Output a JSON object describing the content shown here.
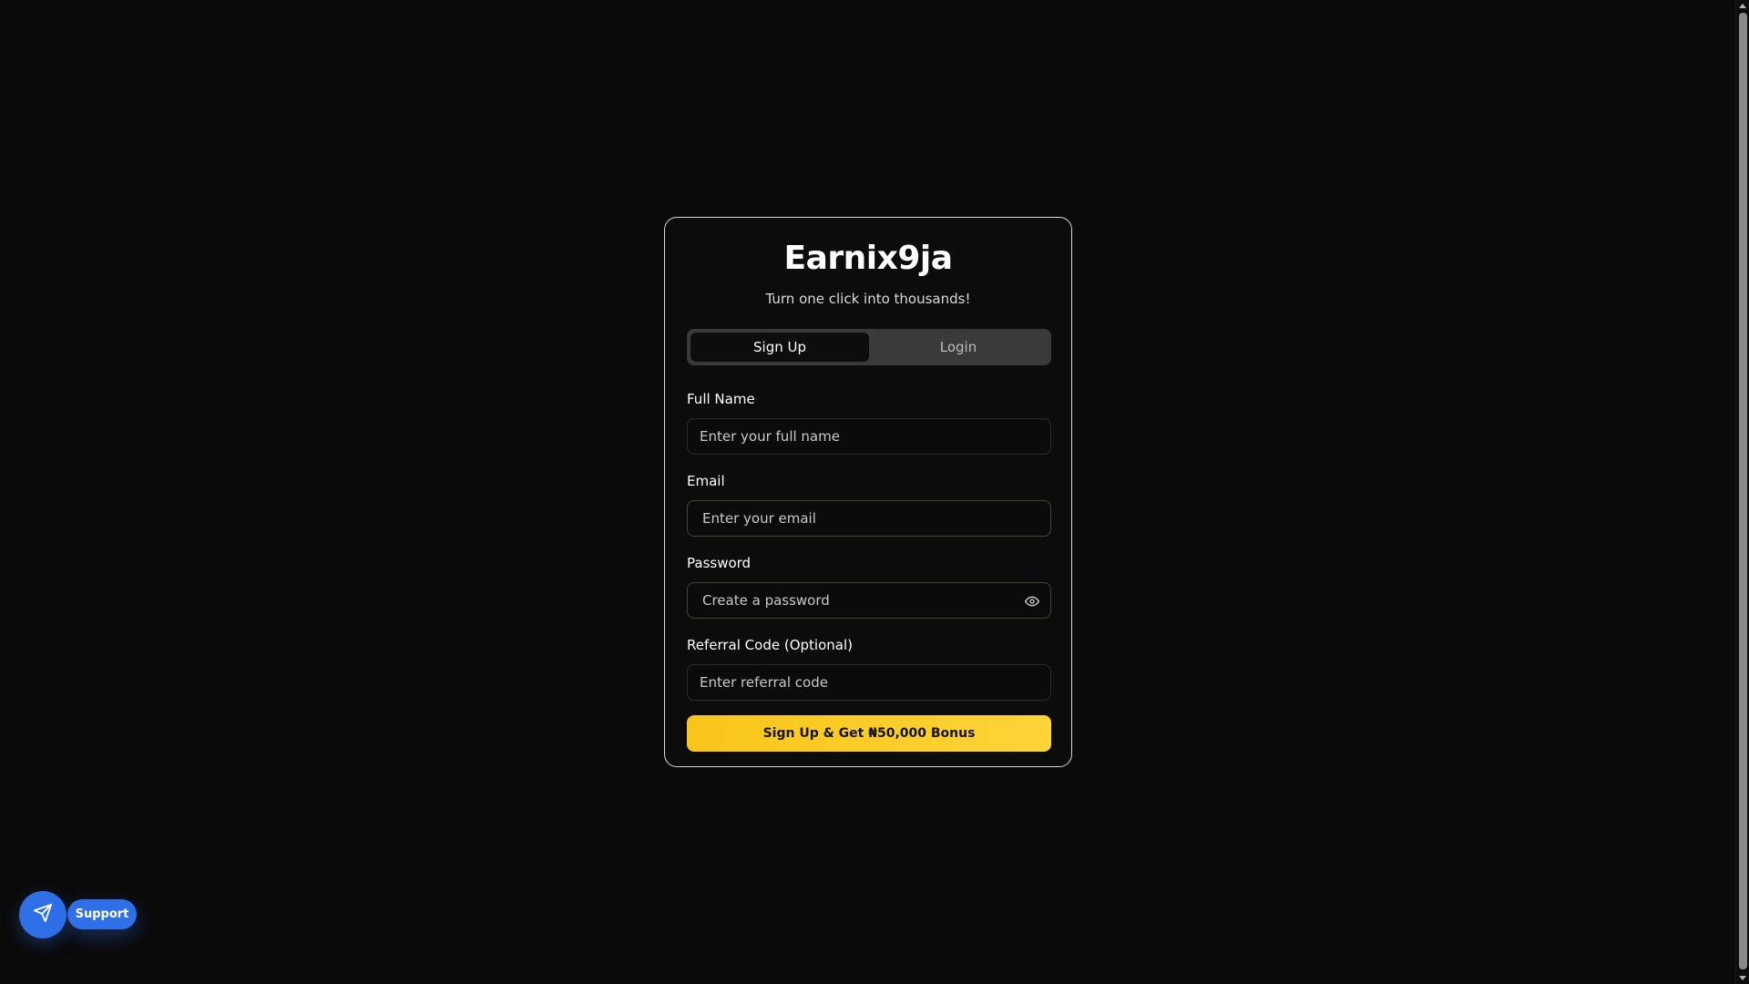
{
  "brand": {
    "name": "Earnix9ja",
    "tagline": "Turn one click into thousands!"
  },
  "tabs": [
    {
      "label": "Sign Up",
      "active": true
    },
    {
      "label": "Login",
      "active": false
    }
  ],
  "form": {
    "full_name": {
      "label": "Full Name",
      "placeholder": "Enter your full name",
      "value": ""
    },
    "email": {
      "label": "Email",
      "placeholder": "Enter your email",
      "value": ""
    },
    "password": {
      "label": "Password",
      "placeholder": "Create a password",
      "value": "",
      "toggle_icon": "eye-icon"
    },
    "referral": {
      "label": "Referral Code (Optional)",
      "placeholder": "Enter referral code",
      "value": ""
    },
    "submit_label": "Sign Up & Get ₦50,000 Bonus"
  },
  "support": {
    "label": "Support",
    "icon": "send-icon",
    "color": "#2f6fe8"
  },
  "colors": {
    "background": "#0a0a0a",
    "accent": "#fcc92a",
    "card_border": "#d9d9d9"
  }
}
